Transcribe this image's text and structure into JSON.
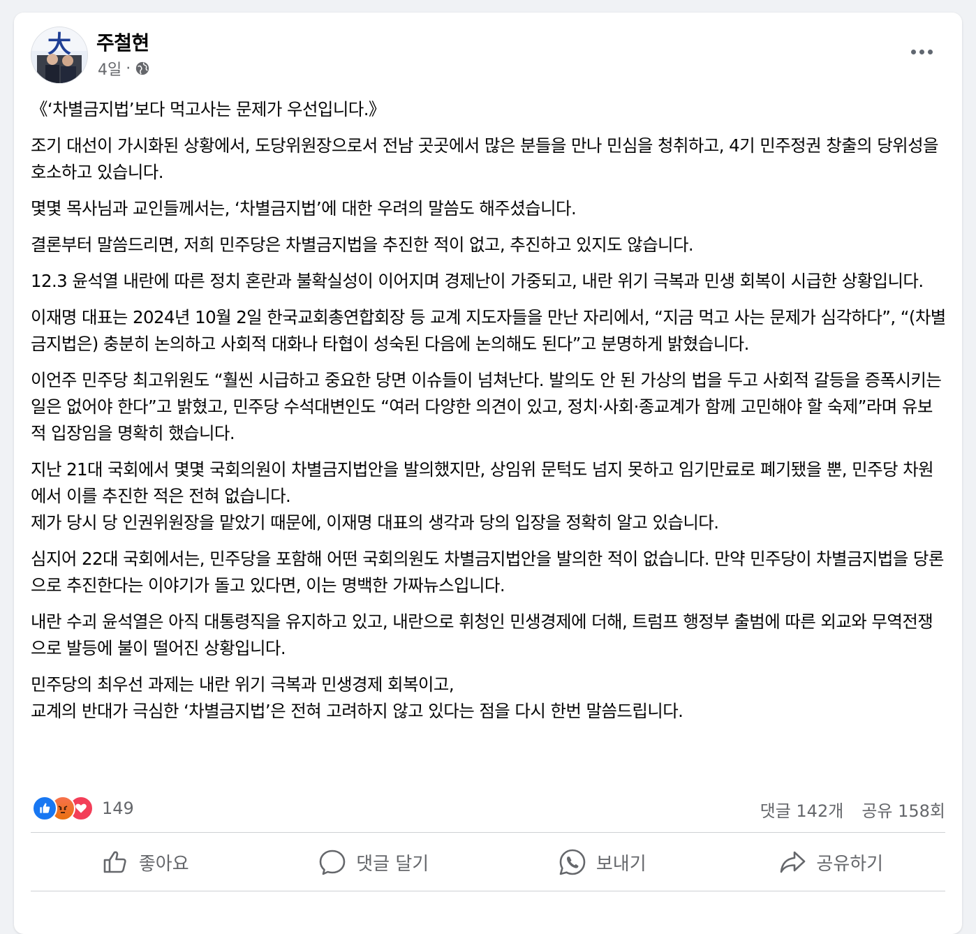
{
  "post": {
    "author": "주철현",
    "time": "4일",
    "separator": "·",
    "avatar_text": "大"
  },
  "content": {
    "paragraphs": [
      "《‘차별금지법’보다 먹고사는 문제가 우선입니다.》",
      "조기 대선이 가시화된 상황에서, 도당위원장으로서 전남 곳곳에서 많은 분들을 만나 민심을 청취하고, 4기 민주정권 창출의 당위성을 호소하고 있습니다.",
      "몇몇 목사님과 교인들께서는, ‘차별금지법’에 대한 우려의 말씀도 해주셨습니다.",
      "결론부터 말씀드리면, 저희 민주당은 차별금지법을 추진한 적이 없고, 추진하고 있지도 않습니다.",
      "12.3 윤석열 내란에 따른 정치 혼란과 불확실성이 이어지며 경제난이 가중되고, 내란 위기 극복과 민생 회복이 시급한 상황입니다.",
      "이재명 대표는 2024년 10월 2일 한국교회총연합회장 등 교계 지도자들을 만난 자리에서, “지금 먹고 사는 문제가 심각하다”, “(차별금지법은) 충분히 논의하고 사회적 대화나 타협이  성숙된 다음에 논의해도 된다”고 분명하게 밝혔습니다.",
      "이언주 민주당 최고위원도 “훨씬 시급하고 중요한 당면 이슈들이 넘쳐난다. 발의도 안 된 가상의 법을 두고 사회적 갈등을 증폭시키는 일은 없어야 한다”고 밝혔고, 민주당 수석대변인도 “여러 다양한 의견이 있고, 정치·사회·종교계가 함께 고민해야 할 숙제”라며 유보적 입장임을 명확히 했습니다.",
      "지난 21대 국회에서 몇몇 국회의원이 차별금지법안을 발의했지만, 상임위 문턱도 넘지 못하고 임기만료로 폐기됐을 뿐, 민주당 차원에서 이를 추진한 적은 전혀 없습니다.\n제가 당시 당 인권위원장을 맡았기 때문에, 이재명 대표의 생각과 당의 입장을 정확히 알고 있습니다.",
      "심지어 22대 국회에서는, 민주당을 포함해 어떤 국회의원도 차별금지법안을 발의한 적이 없습니다. 만약 민주당이 차별금지법을 당론으로 추진한다는 이야기가 돌고 있다면, 이는 명백한 가짜뉴스입니다.",
      "내란 수괴 윤석열은 아직 대통령직을 유지하고 있고, 내란으로 휘청인 민생경제에 더해, 트럼프 행정부 출범에 따른 외교와 무역전쟁으로 발등에 불이 떨어진 상황입니다.",
      "민주당의 최우선 과제는 내란 위기 극복과 민생경제 회복이고,\n교계의 반대가 극심한 ‘차별금지법’은 전혀 고려하지 않고 있다는 점을 다시 한번 말씀드립니다."
    ]
  },
  "reactions": {
    "count": "149",
    "icons": [
      "like-icon",
      "angry-icon",
      "love-icon"
    ]
  },
  "stats": {
    "comments": "댓글 142개",
    "shares": "공유 158회"
  },
  "actions": {
    "like": "좋아요",
    "comment": "댓글 달기",
    "send": "보내기",
    "share": "공유하기"
  },
  "colors": {
    "like_blue": "#1877f2",
    "love_red": "#f33e58",
    "angry_orange": "#e9710f",
    "secondary_text": "#65676b"
  }
}
